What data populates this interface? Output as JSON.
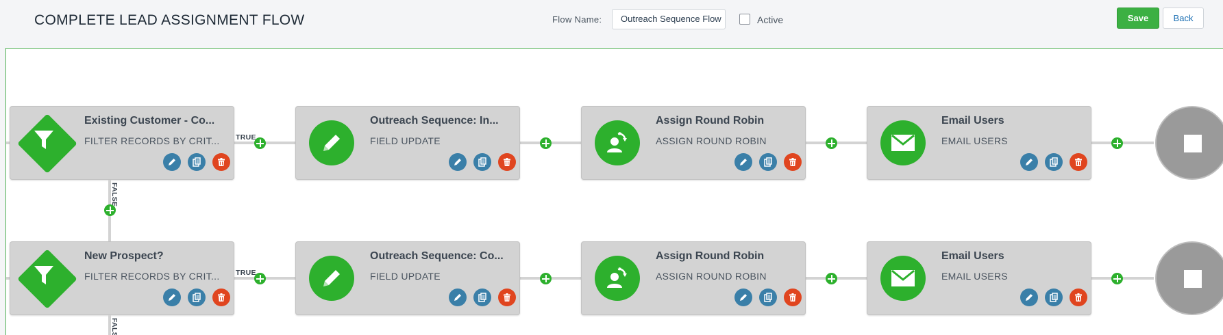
{
  "header": {
    "title": "COMPLETE LEAD ASSIGNMENT FLOW",
    "flow_name_label": "Flow Name:",
    "flow_name_value": "Outreach Sequence Flow",
    "active_label": "Active",
    "active_checked": false,
    "save_label": "Save",
    "back_label": "Back"
  },
  "branch_labels": {
    "true": "TRUE",
    "false": "FALSE"
  },
  "rows": [
    {
      "nodes": [
        {
          "type": "filter",
          "icon": "filter-icon",
          "title": "Existing Customer - Co...",
          "subtitle": "FILTER RECORDS BY CRIT..."
        },
        {
          "type": "field-update",
          "icon": "pencil-icon",
          "title": "Outreach Sequence: In...",
          "subtitle": "FIELD UPDATE"
        },
        {
          "type": "round-robin",
          "icon": "round-robin-user-icon",
          "title": "Assign Round Robin",
          "subtitle": "ASSIGN ROUND ROBIN"
        },
        {
          "type": "email",
          "icon": "envelope-icon",
          "title": "Email Users",
          "subtitle": "EMAIL USERS"
        }
      ]
    },
    {
      "nodes": [
        {
          "type": "filter",
          "icon": "filter-icon",
          "title": "New Prospect?",
          "subtitle": "FILTER RECORDS BY CRIT..."
        },
        {
          "type": "field-update",
          "icon": "pencil-icon",
          "title": "Outreach Sequence: Co...",
          "subtitle": "FIELD UPDATE"
        },
        {
          "type": "round-robin",
          "icon": "round-robin-user-icon",
          "title": "Assign Round Robin",
          "subtitle": "ASSIGN ROUND ROBIN"
        },
        {
          "type": "email",
          "icon": "envelope-icon",
          "title": "Email Users",
          "subtitle": "EMAIL USERS"
        }
      ]
    }
  ],
  "colors": {
    "accent_green": "#2db02d",
    "save_green": "#3cb043",
    "action_blue": "#3a7fa8",
    "delete_red": "#e0451f",
    "node_gray": "#d3d3d3",
    "end_gray": "#9a9a9a"
  }
}
